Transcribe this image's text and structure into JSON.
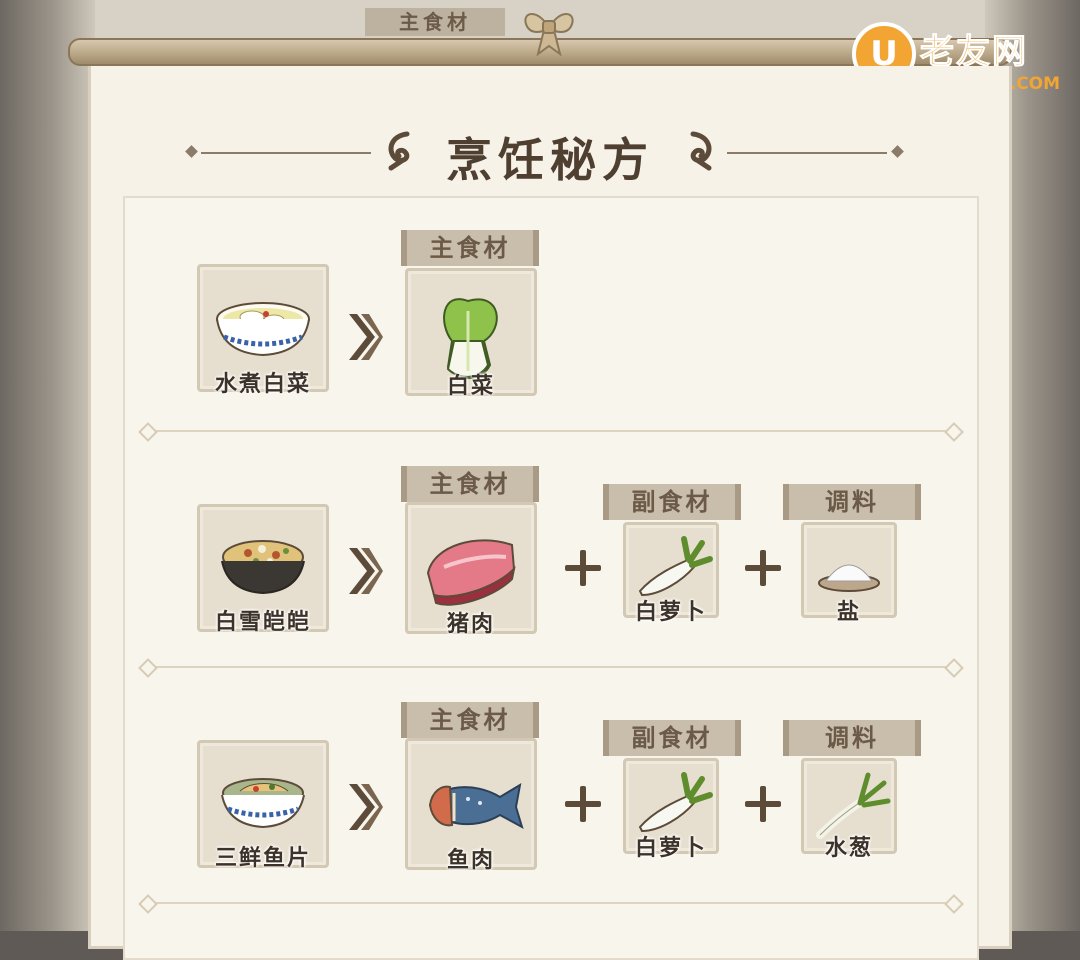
{
  "watermark": {
    "icon_text": "U",
    "title": "老友网",
    "domain": "ANDLAOU.COM"
  },
  "top_tab": "主食材",
  "title": "烹饪秘方",
  "colors": {
    "paper": "#f6f2e8",
    "tile": "#e6dfcf",
    "tag": "#c9beac",
    "accent": "#5d4b39",
    "watermark": "#f2a533"
  },
  "recipes": [
    {
      "dish": {
        "name": "水煮白菜",
        "icon": "bowl-soup-icon"
      },
      "main": {
        "tag": "主食材",
        "name": "白菜",
        "icon": "bok-choy-icon"
      },
      "side": null,
      "seasoning": null
    },
    {
      "dish": {
        "name": "白雪皑皑",
        "icon": "bowl-rice-icon"
      },
      "main": {
        "tag": "主食材",
        "name": "猪肉",
        "icon": "pork-icon"
      },
      "side": {
        "tag": "副食材",
        "name": "白萝卜",
        "icon": "radish-icon"
      },
      "seasoning": {
        "tag": "调料",
        "name": "盐",
        "icon": "salt-icon"
      }
    },
    {
      "dish": {
        "name": "三鲜鱼片",
        "icon": "bowl-fish-icon"
      },
      "main": {
        "tag": "主食材",
        "name": "鱼肉",
        "icon": "fish-icon"
      },
      "side": {
        "tag": "副食材",
        "name": "白萝卜",
        "icon": "radish-icon"
      },
      "seasoning": {
        "tag": "调料",
        "name": "水葱",
        "icon": "scallion-icon"
      }
    }
  ]
}
